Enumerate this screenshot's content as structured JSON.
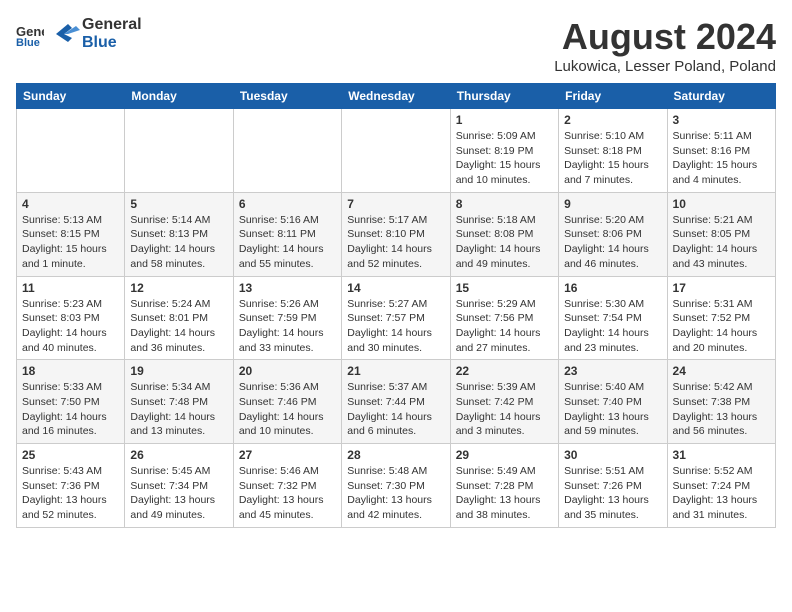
{
  "header": {
    "logo_general": "General",
    "logo_blue": "Blue",
    "month_title": "August 2024",
    "location": "Lukowica, Lesser Poland, Poland"
  },
  "weekdays": [
    "Sunday",
    "Monday",
    "Tuesday",
    "Wednesday",
    "Thursday",
    "Friday",
    "Saturday"
  ],
  "weeks": [
    [
      {
        "day": "",
        "info": ""
      },
      {
        "day": "",
        "info": ""
      },
      {
        "day": "",
        "info": ""
      },
      {
        "day": "",
        "info": ""
      },
      {
        "day": "1",
        "info": "Sunrise: 5:09 AM\nSunset: 8:19 PM\nDaylight: 15 hours\nand 10 minutes."
      },
      {
        "day": "2",
        "info": "Sunrise: 5:10 AM\nSunset: 8:18 PM\nDaylight: 15 hours\nand 7 minutes."
      },
      {
        "day": "3",
        "info": "Sunrise: 5:11 AM\nSunset: 8:16 PM\nDaylight: 15 hours\nand 4 minutes."
      }
    ],
    [
      {
        "day": "4",
        "info": "Sunrise: 5:13 AM\nSunset: 8:15 PM\nDaylight: 15 hours\nand 1 minute."
      },
      {
        "day": "5",
        "info": "Sunrise: 5:14 AM\nSunset: 8:13 PM\nDaylight: 14 hours\nand 58 minutes."
      },
      {
        "day": "6",
        "info": "Sunrise: 5:16 AM\nSunset: 8:11 PM\nDaylight: 14 hours\nand 55 minutes."
      },
      {
        "day": "7",
        "info": "Sunrise: 5:17 AM\nSunset: 8:10 PM\nDaylight: 14 hours\nand 52 minutes."
      },
      {
        "day": "8",
        "info": "Sunrise: 5:18 AM\nSunset: 8:08 PM\nDaylight: 14 hours\nand 49 minutes."
      },
      {
        "day": "9",
        "info": "Sunrise: 5:20 AM\nSunset: 8:06 PM\nDaylight: 14 hours\nand 46 minutes."
      },
      {
        "day": "10",
        "info": "Sunrise: 5:21 AM\nSunset: 8:05 PM\nDaylight: 14 hours\nand 43 minutes."
      }
    ],
    [
      {
        "day": "11",
        "info": "Sunrise: 5:23 AM\nSunset: 8:03 PM\nDaylight: 14 hours\nand 40 minutes."
      },
      {
        "day": "12",
        "info": "Sunrise: 5:24 AM\nSunset: 8:01 PM\nDaylight: 14 hours\nand 36 minutes."
      },
      {
        "day": "13",
        "info": "Sunrise: 5:26 AM\nSunset: 7:59 PM\nDaylight: 14 hours\nand 33 minutes."
      },
      {
        "day": "14",
        "info": "Sunrise: 5:27 AM\nSunset: 7:57 PM\nDaylight: 14 hours\nand 30 minutes."
      },
      {
        "day": "15",
        "info": "Sunrise: 5:29 AM\nSunset: 7:56 PM\nDaylight: 14 hours\nand 27 minutes."
      },
      {
        "day": "16",
        "info": "Sunrise: 5:30 AM\nSunset: 7:54 PM\nDaylight: 14 hours\nand 23 minutes."
      },
      {
        "day": "17",
        "info": "Sunrise: 5:31 AM\nSunset: 7:52 PM\nDaylight: 14 hours\nand 20 minutes."
      }
    ],
    [
      {
        "day": "18",
        "info": "Sunrise: 5:33 AM\nSunset: 7:50 PM\nDaylight: 14 hours\nand 16 minutes."
      },
      {
        "day": "19",
        "info": "Sunrise: 5:34 AM\nSunset: 7:48 PM\nDaylight: 14 hours\nand 13 minutes."
      },
      {
        "day": "20",
        "info": "Sunrise: 5:36 AM\nSunset: 7:46 PM\nDaylight: 14 hours\nand 10 minutes."
      },
      {
        "day": "21",
        "info": "Sunrise: 5:37 AM\nSunset: 7:44 PM\nDaylight: 14 hours\nand 6 minutes."
      },
      {
        "day": "22",
        "info": "Sunrise: 5:39 AM\nSunset: 7:42 PM\nDaylight: 14 hours\nand 3 minutes."
      },
      {
        "day": "23",
        "info": "Sunrise: 5:40 AM\nSunset: 7:40 PM\nDaylight: 13 hours\nand 59 minutes."
      },
      {
        "day": "24",
        "info": "Sunrise: 5:42 AM\nSunset: 7:38 PM\nDaylight: 13 hours\nand 56 minutes."
      }
    ],
    [
      {
        "day": "25",
        "info": "Sunrise: 5:43 AM\nSunset: 7:36 PM\nDaylight: 13 hours\nand 52 minutes."
      },
      {
        "day": "26",
        "info": "Sunrise: 5:45 AM\nSunset: 7:34 PM\nDaylight: 13 hours\nand 49 minutes."
      },
      {
        "day": "27",
        "info": "Sunrise: 5:46 AM\nSunset: 7:32 PM\nDaylight: 13 hours\nand 45 minutes."
      },
      {
        "day": "28",
        "info": "Sunrise: 5:48 AM\nSunset: 7:30 PM\nDaylight: 13 hours\nand 42 minutes."
      },
      {
        "day": "29",
        "info": "Sunrise: 5:49 AM\nSunset: 7:28 PM\nDaylight: 13 hours\nand 38 minutes."
      },
      {
        "day": "30",
        "info": "Sunrise: 5:51 AM\nSunset: 7:26 PM\nDaylight: 13 hours\nand 35 minutes."
      },
      {
        "day": "31",
        "info": "Sunrise: 5:52 AM\nSunset: 7:24 PM\nDaylight: 13 hours\nand 31 minutes."
      }
    ]
  ]
}
